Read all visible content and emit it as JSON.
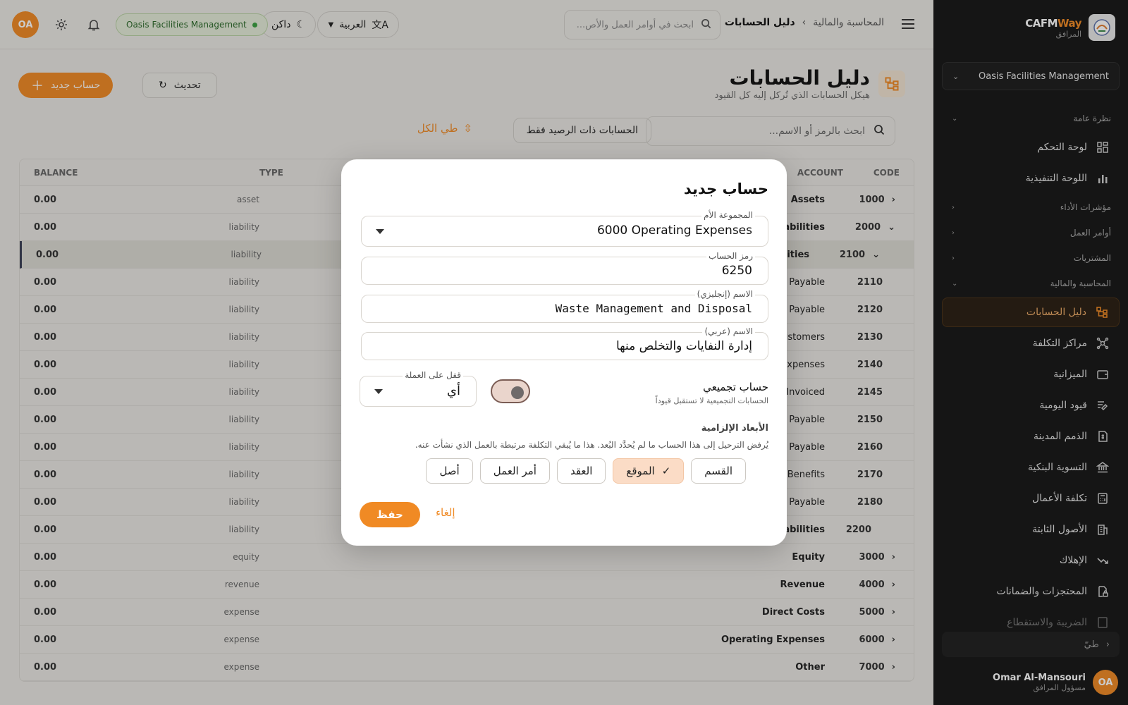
{
  "brand": {
    "name_a": "CAFM",
    "name_b": "Way",
    "sub": "المرافق"
  },
  "sidebar": {
    "org": "Oasis Facilities Management",
    "sections": {
      "overview": "نظرة عامة",
      "kpi": "مؤشرات الأداء",
      "workorders": "أوامر العمل",
      "procurement": "المشتريات",
      "finance": "المحاسبة والمالية"
    },
    "items": {
      "dashboard": "لوحة التحكم",
      "executive": "اللوحة التنفيذية",
      "coa": "دليل الحسابات",
      "costcenters": "مراكز التكلفة",
      "budget": "الميزانية",
      "journal": "قيود اليومية",
      "payables": "الذمم المدينة",
      "bankrec": "التسوية البنكية",
      "jobcost": "تكلفة الأعمال",
      "fixedassets": "الأصول الثابتة",
      "depreciation": "الإهلاك",
      "retentions": "المحتجزات والضمانات",
      "tax": "الضريبة والاستقطاع"
    },
    "collapse": "طيّ",
    "user": {
      "name": "Omar Al-Mansouri",
      "role": "مسؤول المرافق",
      "initials": "OA"
    }
  },
  "topbar": {
    "breadcrumb_parent": "المحاسبة والمالية",
    "breadcrumb_current": "دليل الحسابات",
    "search_placeholder": "ابحث في أوامر العمل والأص...",
    "language": "العربية",
    "theme": "داكن",
    "org_badge": "Oasis Facilities Management",
    "avatar": "OA"
  },
  "page": {
    "title": "دليل الحسابات",
    "subtitle": "هيكل الحسابات الذي تُركل إليه كل القيود",
    "new_account": "حساب جديد",
    "refresh": "تحديث",
    "search_placeholder": "ابحث بالرمز أو الاسم...",
    "balance_filter": "الحسابات ذات الرصيد فقط",
    "collapse_all": "طي الكل"
  },
  "table": {
    "headers": {
      "code": "CODE",
      "account": "ACCOUNT",
      "type": "TYPE",
      "balance": "BALANCE"
    },
    "rows": [
      {
        "code": "1000",
        "name": "Assets",
        "type": "asset",
        "balance": "0.00"
      },
      {
        "code": "2000",
        "name": "Liabilities",
        "type": "liability",
        "balance": "0.00"
      },
      {
        "code": "2100",
        "name": "Current Liabilities",
        "type": "liability",
        "balance": "0.00"
      },
      {
        "code": "2110",
        "name": "Accounts Payable",
        "type": "liability",
        "balance": "0.00"
      },
      {
        "code": "2120",
        "name": "Retention Payable",
        "type": "liability",
        "balance": "0.00"
      },
      {
        "code": "2130",
        "name": "Advances from Customers",
        "type": "liability",
        "balance": "0.00"
      },
      {
        "code": "2140",
        "name": "Accrued Expenses",
        "type": "liability",
        "balance": "0.00"
      },
      {
        "code": "2145",
        "name": "Goods Received Not Invoiced",
        "type": "liability",
        "balance": "0.00"
      },
      {
        "code": "2150",
        "name": "VAT Payable",
        "type": "liability",
        "balance": "0.00"
      },
      {
        "code": "2160",
        "name": "Withholding Tax Payable",
        "type": "liability",
        "balance": "0.00"
      },
      {
        "code": "2170",
        "name": "End of Service Benefits",
        "type": "liability",
        "balance": "0.00"
      },
      {
        "code": "2180",
        "name": "Salaries Payable",
        "type": "liability",
        "balance": "0.00"
      },
      {
        "code": "2200",
        "name": "Non-Current Liabilities",
        "type": "liability",
        "balance": "0.00"
      },
      {
        "code": "3000",
        "name": "Equity",
        "type": "equity",
        "balance": "0.00"
      },
      {
        "code": "4000",
        "name": "Revenue",
        "type": "revenue",
        "balance": "0.00"
      },
      {
        "code": "5000",
        "name": "Direct Costs",
        "type": "expense",
        "balance": "0.00"
      },
      {
        "code": "6000",
        "name": "Operating Expenses",
        "type": "expense",
        "balance": "0.00"
      },
      {
        "code": "7000",
        "name": "Other",
        "type": "expense",
        "balance": "0.00"
      }
    ]
  },
  "modal": {
    "title": "حساب جديد",
    "parent_label": "المجموعة الأم",
    "parent_value": "6000  Operating Expenses",
    "code_label": "رمز الحساب",
    "code_value": "6250",
    "name_en_label": "الاسم (إنجليزي)",
    "name_en_value": "Waste Management and Disposal",
    "name_ar_label": "الاسم (عربي)",
    "name_ar_value": "إدارة النفايات والتخلص منها",
    "aggregate_label": "حساب تجميعي",
    "aggregate_sub": "الحسابات التجميعية لا تستقبل قيوداً",
    "currency_label": "قفل على العملة",
    "currency_value": "أي",
    "dims_title": "الأبعاد الإلزامية",
    "dims_desc": "يُرفض الترحيل إلى هذا الحساب ما لم يُحدَّد البُعد. هذا ما يُبقي التكلفة مرتبطة بالعمل الذي نشأت عنه.",
    "chips": {
      "division": "القسم",
      "site": "الموقع",
      "contract": "العقد",
      "workorder": "أمر العمل",
      "asset": "أصل"
    },
    "save": "حفظ",
    "cancel": "إلغاء"
  },
  "colors": {
    "accent": "#f08a24",
    "sidebar": "#161616",
    "ok": "#3aa040"
  }
}
